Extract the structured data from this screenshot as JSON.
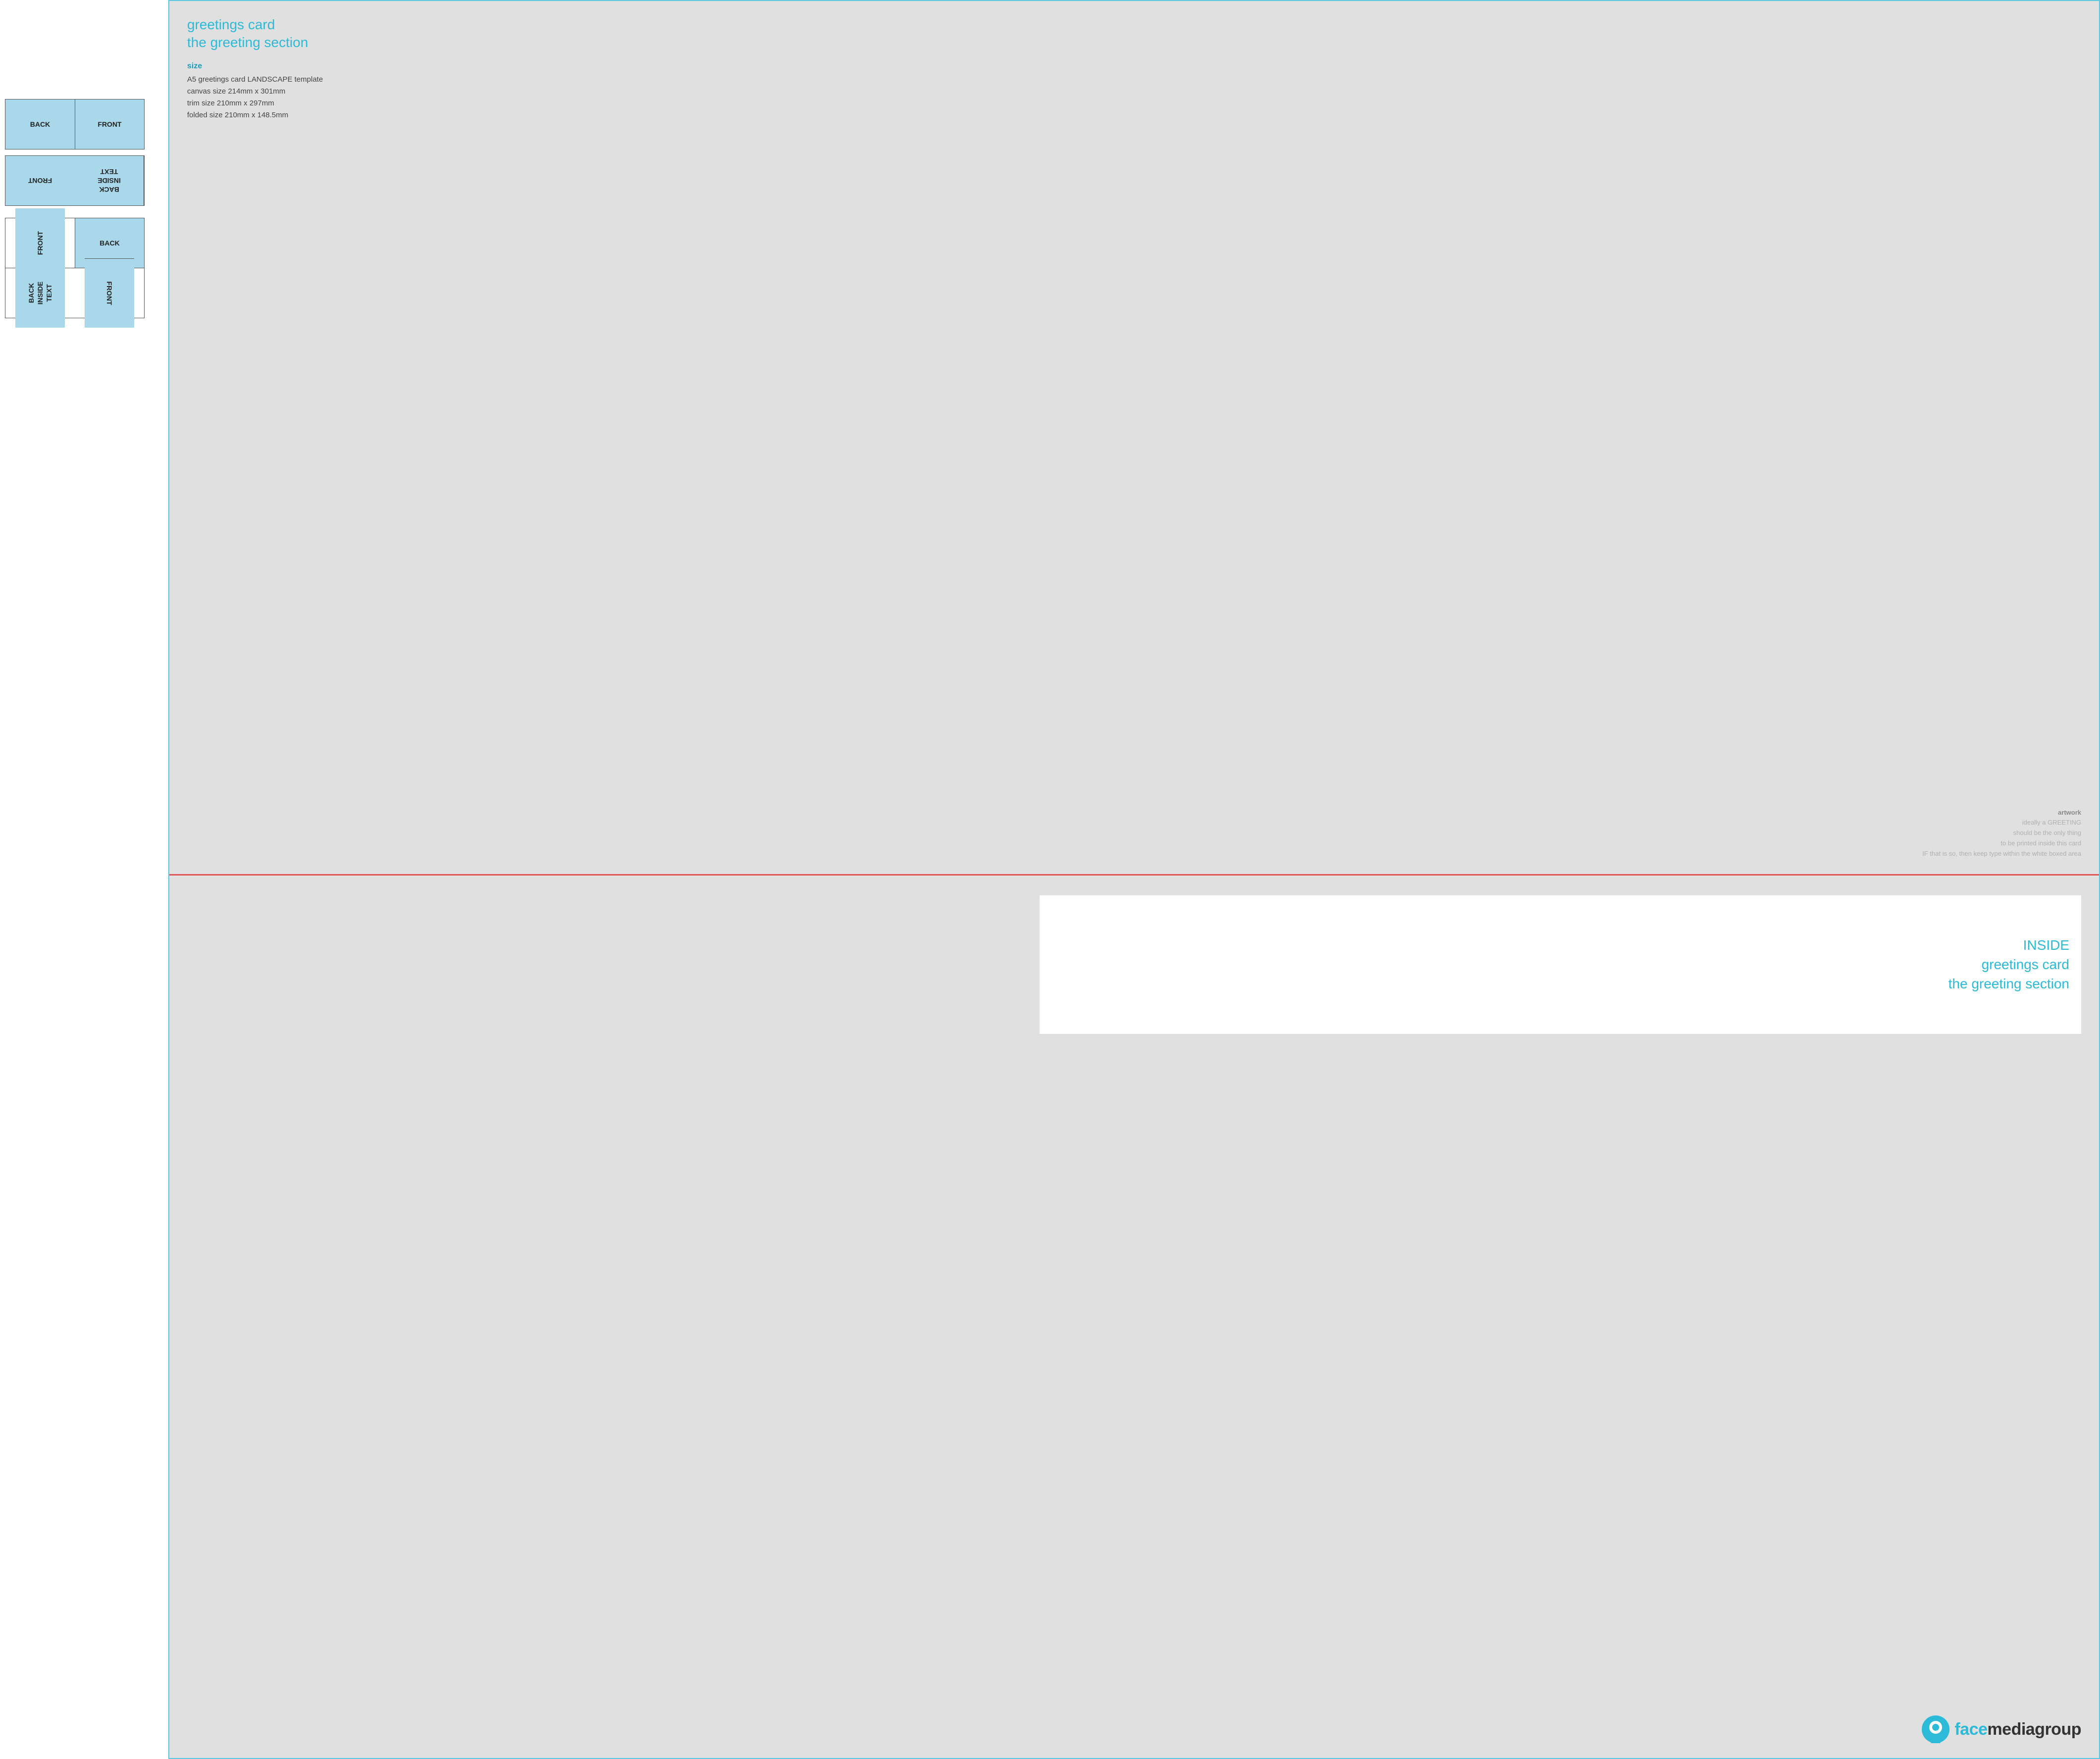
{
  "left": {
    "group1": {
      "row1": [
        {
          "label": "BACK",
          "style": "normal"
        },
        {
          "label": "FRONT",
          "style": "normal"
        }
      ],
      "row2": [
        {
          "label": "FRONT",
          "style": "flipped"
        },
        {
          "label": "BACK\nINSIDE\nTEXT",
          "style": "flipped"
        }
      ]
    },
    "group2": {
      "row1": [
        {
          "label": "FRONT",
          "style": "rotated-left"
        },
        {
          "label": "BACK",
          "style": "normal"
        }
      ],
      "row2": [
        {
          "label": "BACK\nINSIDE\nTEXT",
          "style": "rotated-left"
        },
        {
          "label": "FRONT",
          "style": "rotated-right"
        }
      ]
    }
  },
  "right": {
    "top": {
      "title_line1": "greetings card",
      "title_line2": "the greeting section",
      "size_label": "size",
      "size_line1": "A5 greetings card LANDSCAPE template",
      "size_line2": "canvas size 214mm x 301mm",
      "size_line3": "trim size 210mm x 297mm",
      "size_line4": "folded size 210mm x 148.5mm",
      "artwork_label": "artwork",
      "artwork_line1": "ideally a GREETING",
      "artwork_line2": "should be the only thing",
      "artwork_line3": "to be printed inside this card",
      "artwork_line4": "IF that is so, then keep type within the white boxed area"
    },
    "bottom": {
      "inside_line1": "INSIDE",
      "inside_line2": "greetings card",
      "inside_line3": "the greeting section",
      "logo_face": "face",
      "logo_media": "media",
      "logo_group": "group"
    }
  }
}
